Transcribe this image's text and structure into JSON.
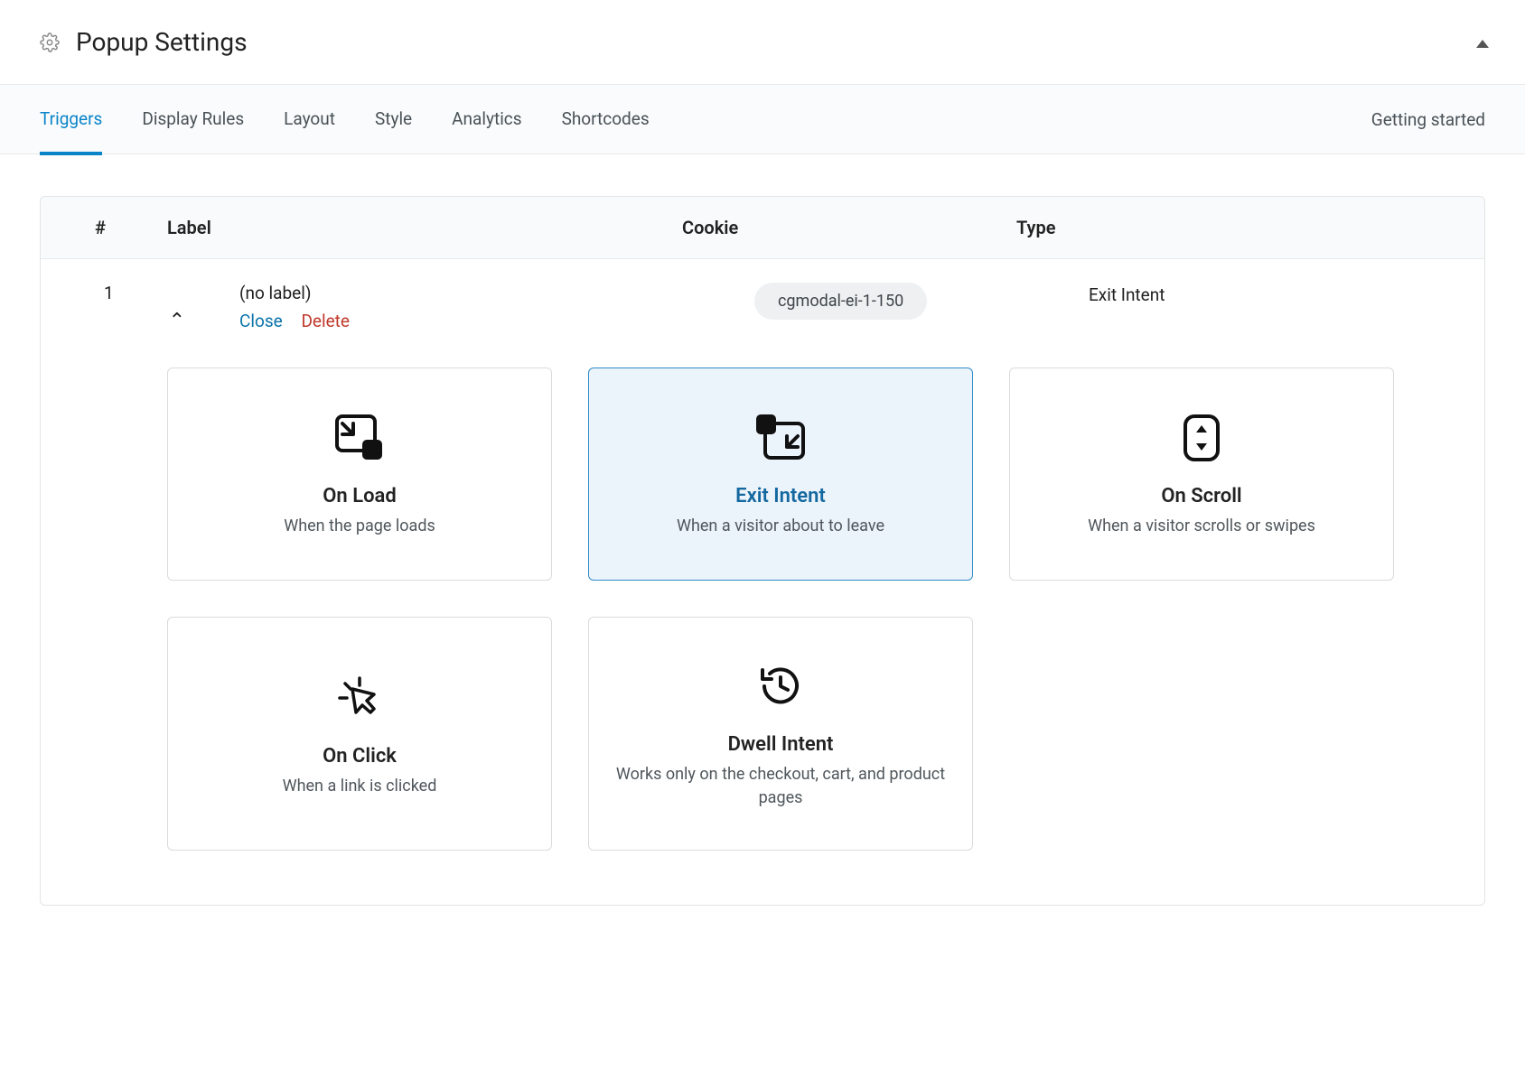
{
  "header": {
    "title": "Popup Settings"
  },
  "tabs": [
    {
      "label": "Triggers",
      "active": true
    },
    {
      "label": "Display Rules",
      "active": false
    },
    {
      "label": "Layout",
      "active": false
    },
    {
      "label": "Style",
      "active": false
    },
    {
      "label": "Analytics",
      "active": false
    },
    {
      "label": "Shortcodes",
      "active": false
    }
  ],
  "getting_started": "Getting started",
  "table": {
    "headers": {
      "num": "#",
      "label": "Label",
      "cookie": "Cookie",
      "type": "Type"
    },
    "rows": [
      {
        "num": "1",
        "label": "(no label)",
        "close": "Close",
        "delete": "Delete",
        "cookie": "cgmodal-ei-1-150",
        "type": "Exit Intent"
      }
    ]
  },
  "trigger_types": [
    {
      "key": "on-load",
      "title": "On Load",
      "sub": "When the page loads",
      "selected": false
    },
    {
      "key": "exit-intent",
      "title": "Exit Intent",
      "sub": "When a visitor about to leave",
      "selected": true
    },
    {
      "key": "on-scroll",
      "title": "On Scroll",
      "sub": "When a visitor scrolls or swipes",
      "selected": false
    },
    {
      "key": "on-click",
      "title": "On Click",
      "sub": "When a link is clicked",
      "selected": false
    },
    {
      "key": "dwell-intent",
      "title": "Dwell Intent",
      "sub": "Works only on the checkout, cart, and product pages",
      "selected": false
    }
  ]
}
